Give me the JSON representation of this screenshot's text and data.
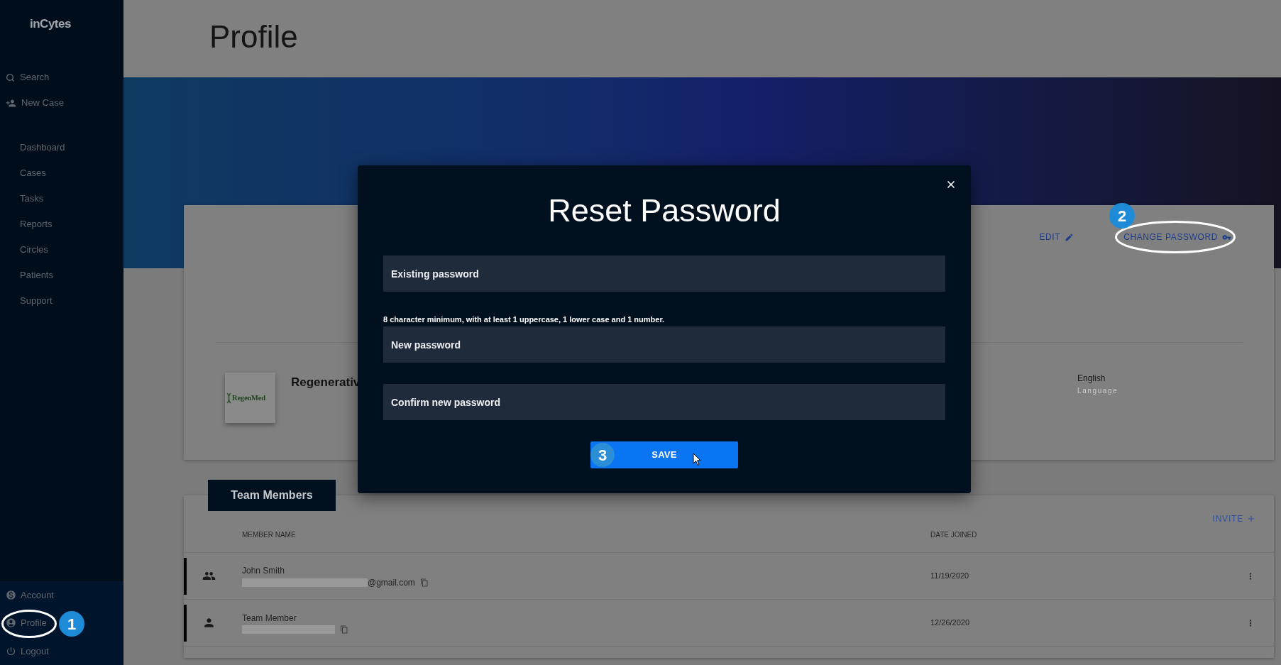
{
  "sidebar": {
    "logo": "inCytes",
    "top_items": [
      {
        "label": "Search"
      },
      {
        "label": "New Case"
      }
    ],
    "nav_items": [
      {
        "label": "Dashboard"
      },
      {
        "label": "Cases"
      },
      {
        "label": "Tasks"
      },
      {
        "label": "Reports"
      },
      {
        "label": "Circles"
      },
      {
        "label": "Patients"
      },
      {
        "label": "Support"
      }
    ],
    "bottom_items": [
      {
        "label": "Account",
        "circled": false
      },
      {
        "label": "Profile",
        "circled": true,
        "callout": "1"
      },
      {
        "label": "Logout",
        "circled": false
      }
    ]
  },
  "header": {
    "title": "Profile"
  },
  "profile_card": {
    "actions": [
      {
        "label": "EDIT",
        "circled": false
      },
      {
        "label": "CHANGE PASSWORD",
        "circled": true,
        "callout": "2"
      }
    ],
    "organization": {
      "logo_text": "RegenMed",
      "name": "Regenerativ"
    },
    "language": {
      "value": "English",
      "label": "Language"
    }
  },
  "team_members": {
    "heading": "Team Members",
    "invite": "INVITE",
    "columns": [
      "MEMBER NAME",
      "DATE JOINED"
    ],
    "rows": [
      {
        "kind": "group",
        "name": "John Smith",
        "email_redacted": true,
        "email_suffix": "@gmail.com",
        "date_joined": "11/19/2020"
      },
      {
        "kind": "individual",
        "name": "Team Member",
        "email_redacted": true,
        "date_joined": "12/26/2020"
      }
    ]
  },
  "modal": {
    "title": "Reset Password",
    "fields": [
      {
        "placeholder": "Existing password"
      },
      {
        "hint": "8 character minimum, with at least 1 uppercase, 1 lower case and 1 number.",
        "placeholder": "New password"
      },
      {
        "placeholder": "Confirm new password"
      }
    ],
    "save_button": {
      "label": "SAVE",
      "callout": "3"
    }
  }
}
